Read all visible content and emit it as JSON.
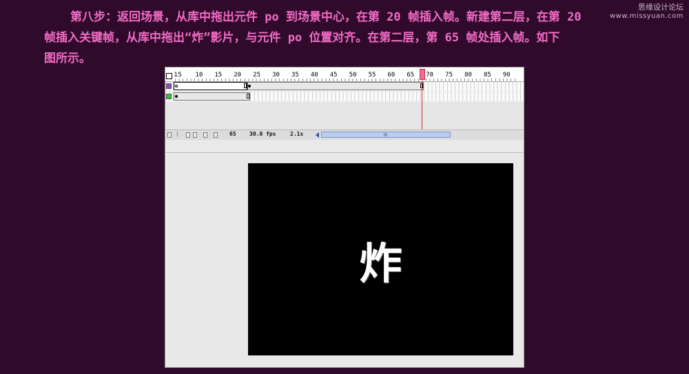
{
  "watermark": {
    "line1": "思缘设计论坛",
    "line2": "www.missyuan.com"
  },
  "instructions": {
    "line1": "第八步：返回场景，从库中拖出元件 po 到场景中心，在第 20 帧插入帧。新建第二层，在第 20",
    "line2": "帧插入关键帧，从库中拖出“炸”影片，与元件 po 位置对齐。在第二层，第 65 帧处插入帧。如下",
    "line3": "图所示。"
  },
  "timeline": {
    "ruler_ticks": [
      "1",
      "5",
      "10",
      "15",
      "20",
      "25",
      "30",
      "35",
      "40",
      "45",
      "50",
      "55",
      "60",
      "65",
      "70",
      "75",
      "80",
      "85",
      "90"
    ],
    "current_frame": 65,
    "layers": [
      {
        "icon_color": "#8a4fc4",
        "first_span_end": 20,
        "second_span_end": 65
      },
      {
        "icon_color": "#36c236",
        "first_span_end": 20
      }
    ],
    "status": {
      "frame": "65",
      "fps": "30.0 fps",
      "time": "2.1s"
    }
  },
  "stage": {
    "symbol_text": "炸"
  }
}
